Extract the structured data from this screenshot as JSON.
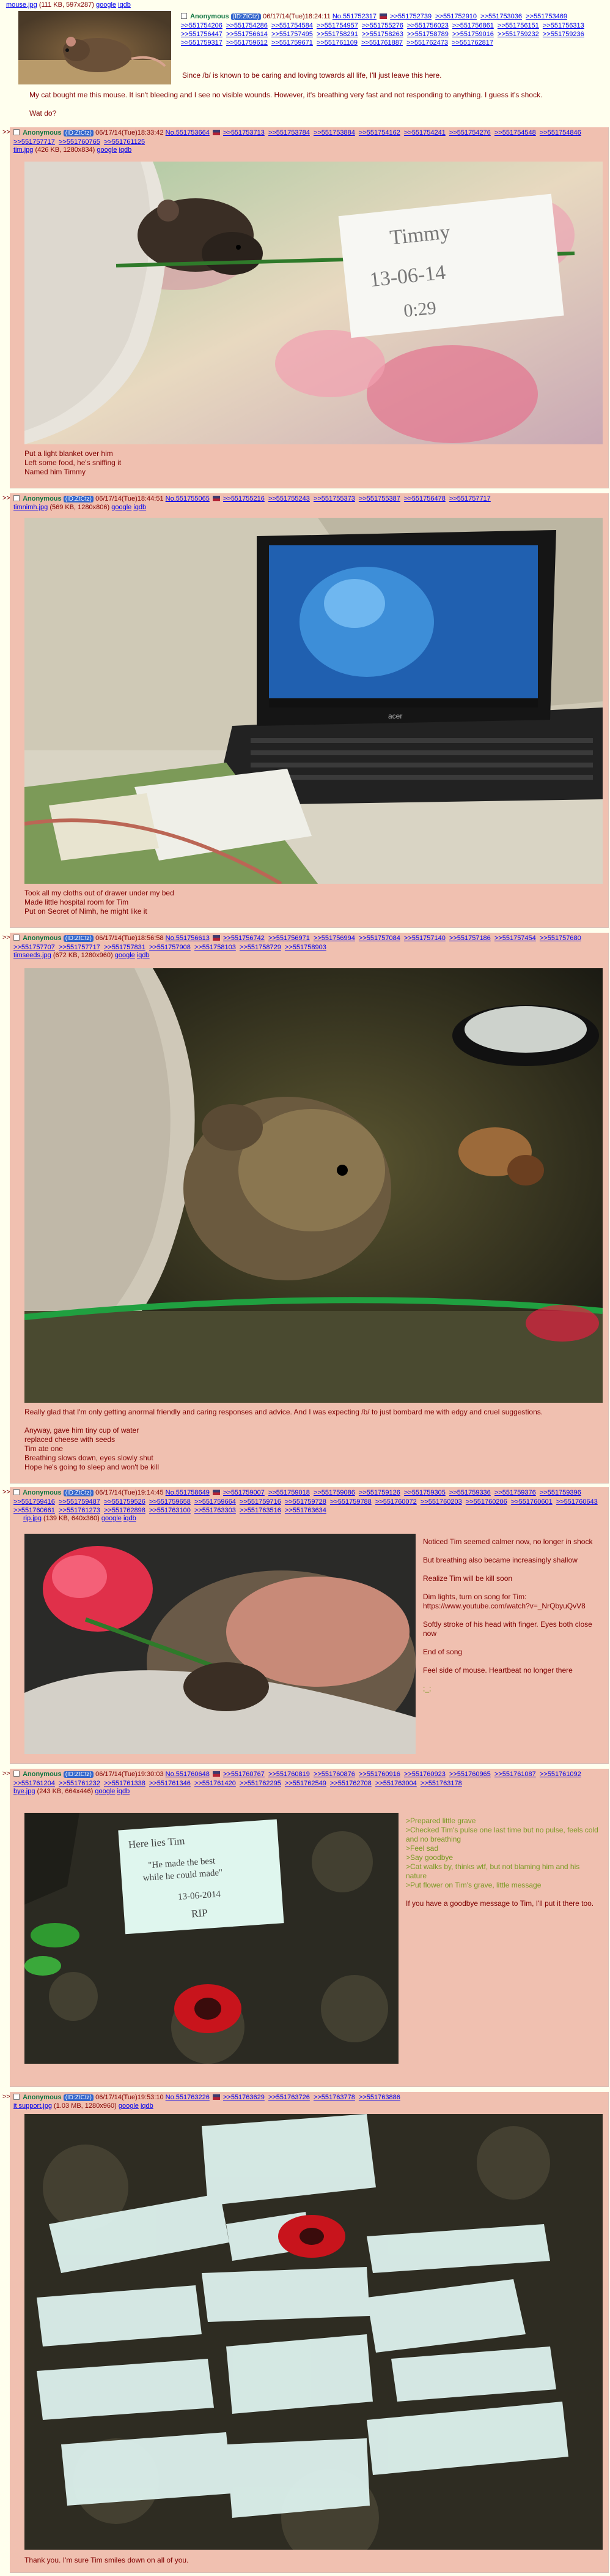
{
  "op": {
    "file_link": "mouse.jpg",
    "file_meta": "(111 KB, 597x287)",
    "google": "google",
    "iqdb": "iqdb",
    "name": "Anonymous",
    "id_tag": "(ID:ZtCtz)",
    "datetime": "06/17/14(Tue)18:24:11",
    "post_no": "No.551752317",
    "backlinks": [
      ">>551752739",
      ">>551752910",
      ">>551753036",
      ">>551753469",
      ">>551754206",
      ">>551754286",
      ">>551754584",
      ">>551754957",
      ">>551755276",
      ">>551756023",
      ">>551756861",
      ">>551756151",
      ">>551756313",
      ">>551756447",
      ">>551756614",
      ">>551757495",
      ">>551758291",
      ">>551758263",
      ">>551758789",
      ">>551759016",
      ">>551759232",
      ">>551759236",
      ">>551759317",
      ">>551759612",
      ">>551759671",
      ">>551761109",
      ">>551761887",
      ">>551762473",
      ">>551762817"
    ],
    "message": [
      "Since /b/ is known to be caring and loving towards all life, I'll just leave this here.",
      "My cat bought me this mouse. It isn't bleeding and I see no visible wounds. However, it's breathing very fast and not responding to anything. I guess it's shock.",
      "Wat do?"
    ]
  },
  "posts": [
    {
      "name": "Anonymous",
      "id_tag": "(ID:ZtCtz)",
      "datetime": "06/17/14(Tue)18:33:42",
      "post_no": "No.551753664",
      "backlinks": [
        ">>551753713",
        ">>551753784",
        ">>551753884",
        ">>551754162",
        ">>551754241",
        ">>551754276",
        ">>551754548",
        ">>551754846",
        ">>551757717",
        ">>551760765",
        ">>551761125"
      ],
      "file_link": "tim.jpg",
      "file_meta": "(426 KB, 1280x834)",
      "google": "google",
      "iqdb": "iqdb",
      "photo_text": [
        "Timmy",
        "13-06-14",
        "0:29"
      ],
      "message": [
        "Put a light blanket over him",
        "Left some food, he's sniffing it",
        "Named him Timmy"
      ]
    },
    {
      "name": "Anonymous",
      "id_tag": "(ID:ZtCtz)",
      "datetime": "06/17/14(Tue)18:44:51",
      "post_no": "No.551755065",
      "backlinks": [
        ">>551755216",
        ">>551755243",
        ">>551755373",
        ">>551755387",
        ">>551756478",
        ">>551757717"
      ],
      "file_link": "timnimh.jpg",
      "file_meta": "(569 KB, 1280x806)",
      "google": "google",
      "iqdb": "iqdb",
      "laptop_brand": "acer",
      "message": [
        "Took all my cloths out of drawer under my bed",
        "Made little hospital room for Tim",
        "Put on Secret of Nimh, he might like it"
      ]
    },
    {
      "name": "Anonymous",
      "id_tag": "(ID:ZtCtz)",
      "datetime": "06/17/14(Tue)18:56:58",
      "post_no": "No.551756613",
      "backlinks": [
        ">>551756742",
        ">>551756971",
        ">>551756994",
        ">>551757084",
        ">>551757140",
        ">>551757186",
        ">>551757454",
        ">>551757680",
        ">>551757707",
        ">>551757717",
        ">>551757831",
        ">>551757908",
        ">>551758103",
        ">>551758729",
        ">>551758903"
      ],
      "file_link": "timseeds.jpg",
      "file_meta": "(672 KB, 1280x960)",
      "google": "google",
      "iqdb": "iqdb",
      "message_lead": "Really glad that I'm only getting anormal friendly and caring responses and advice. And I was expecting /b/ to just bombard me with edgy and cruel suggestions.",
      "message": [
        "Anyway, gave him tiny cup of water",
        "replaced cheese with seeds",
        "Tim ate one",
        "Breathing slows down, eyes slowly shut",
        "Hope he's going to sleep and won't be kill"
      ]
    },
    {
      "name": "Anonymous",
      "id_tag": "(ID:ZtCtz)",
      "datetime": "06/17/14(Tue)19:14:45",
      "post_no": "No.551758649",
      "backlinks": [
        ">>551759007",
        ">>551759018",
        ">>551759086",
        ">>551759126",
        ">>551759305",
        ">>551759336",
        ">>551759376",
        ">>551759396",
        ">>551759416",
        ">>551759487",
        ">>551759526",
        ">>551759658",
        ">>551759664",
        ">>551759716",
        ">>551759728",
        ">>551759788",
        ">>551760072",
        ">>551760203",
        ">>551760206",
        ">>551760601",
        ">>551760643",
        ">>551760661",
        ">>551761273",
        ">>551762898",
        ">>551763100",
        ">>551763303",
        ">>551763516",
        ">>551763634"
      ],
      "file_link": "rip.jpg",
      "file_meta": "(139 KB, 640x360)",
      "google": "google",
      "iqdb": "iqdb",
      "message": [
        "Noticed Tim seemed calmer now, no longer in shock",
        "But breathing also became increasingly shallow",
        "Realize Tim will be kill soon",
        "Dim lights, turn on song for Tim: https://www.youtube.com/watch?v=_NrQbyuQvV8",
        "Softly stroke of his head with finger. Eyes both close now",
        "End of song",
        "Feel side of mouse. Heartbeat no longer there",
        ";_;"
      ]
    },
    {
      "name": "Anonymous",
      "id_tag": "(ID:ZtCtz)",
      "datetime": "06/17/14(Tue)19:30:03",
      "post_no": "No.551760648",
      "backlinks": [
        ">>551760767",
        ">>551760819",
        ">>551760876",
        ">>551760916",
        ">>551760923",
        ">>551760965",
        ">>551761087",
        ">>551761092",
        ">>551761204",
        ">>551761232",
        ">>551761338",
        ">>551761346",
        ">>551761420",
        ">>551762295",
        ">>551762549",
        ">>551762708",
        ">>551763004",
        ">>551763178"
      ],
      "file_link": "bye.jpg",
      "file_meta": "(243 KB, 664x446)",
      "google": "google",
      "iqdb": "iqdb",
      "photo_text": [
        "Here lies Tim",
        "\"He made the best",
        "while he could made\"",
        "13-06-2014",
        "RIP"
      ],
      "greentext": [
        ">Prepared little grave",
        ">Checked Tim's pulse one last time but no pulse, feels cold and no breathing",
        ">Feel sad",
        ">Say goodbye",
        ">Cat walks by, thinks wtf, but not blaming him and his nature",
        ">Put flower on Tim's grave, little message"
      ],
      "message": [
        "If you have a goodbye message to Tim, I'll put it there too."
      ]
    },
    {
      "name": "Anonymous",
      "id_tag": "(ID:ZtCtz)",
      "datetime": "06/17/14(Tue)19:53:10",
      "post_no": "No.551763226",
      "backlinks": [
        ">>551763629",
        ">>551763726",
        ">>551763778",
        ">>551763886"
      ],
      "file_link": "it support.jpg",
      "file_meta": "(1.03 MB, 1280x960)",
      "google": "google",
      "iqdb": "iqdb",
      "message": [
        "Thank you. I'm sure Tim smiles down on all of you."
      ]
    }
  ],
  "colors": {
    "board_bg": "#ffffee",
    "reply_bg": "#f0c0b0",
    "text": "#800000",
    "link": "#0000ee",
    "name": "#117743",
    "greentext": "#789922",
    "op_bg": "#ffffcc"
  }
}
